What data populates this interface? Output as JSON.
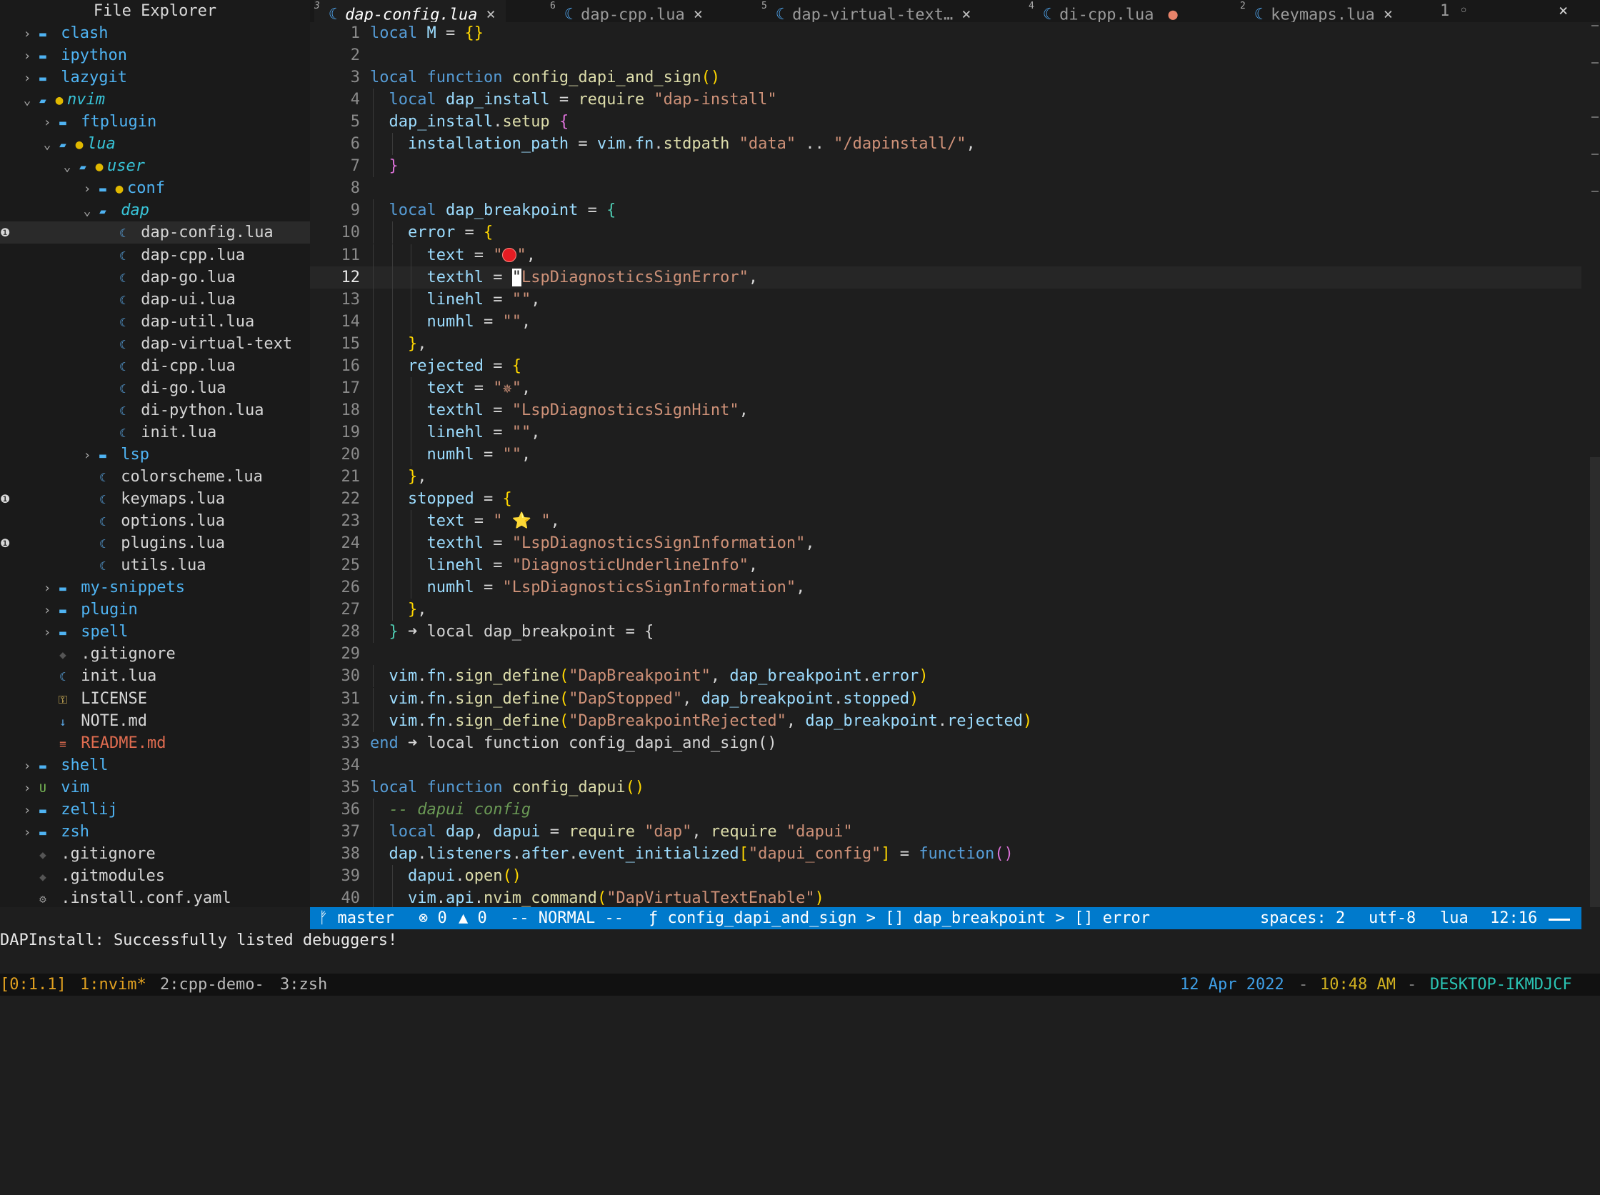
{
  "sidebar": {
    "title": "File Explorer",
    "items": [
      {
        "label": "clash",
        "kind": "folder",
        "depth": 0,
        "chevron": "right"
      },
      {
        "label": "ipython",
        "kind": "folder",
        "depth": 0,
        "chevron": "right"
      },
      {
        "label": "lazygit",
        "kind": "folder",
        "depth": 0,
        "chevron": "right"
      },
      {
        "label": "nvim",
        "kind": "open",
        "depth": 0,
        "chevron": "down",
        "dot": "●"
      },
      {
        "label": "ftplugin",
        "kind": "folder",
        "depth": 1,
        "chevron": "right"
      },
      {
        "label": "lua",
        "kind": "open",
        "depth": 1,
        "chevron": "down",
        "dot": "●"
      },
      {
        "label": "user",
        "kind": "open",
        "depth": 2,
        "chevron": "down",
        "dot": "●"
      },
      {
        "label": "conf",
        "kind": "folder",
        "depth": 3,
        "chevron": "right",
        "dot": "●"
      },
      {
        "label": "dap",
        "kind": "open",
        "depth": 3,
        "chevron": "down"
      },
      {
        "label": "dap-config.lua",
        "kind": "lua",
        "depth": 4,
        "selected": true,
        "diag": "❶"
      },
      {
        "label": "dap-cpp.lua",
        "kind": "lua",
        "depth": 4
      },
      {
        "label": "dap-go.lua",
        "kind": "lua",
        "depth": 4
      },
      {
        "label": "dap-ui.lua",
        "kind": "lua",
        "depth": 4
      },
      {
        "label": "dap-util.lua",
        "kind": "lua",
        "depth": 4
      },
      {
        "label": "dap-virtual-text",
        "kind": "lua",
        "depth": 4
      },
      {
        "label": "di-cpp.lua",
        "kind": "lua",
        "depth": 4
      },
      {
        "label": "di-go.lua",
        "kind": "lua",
        "depth": 4
      },
      {
        "label": "di-python.lua",
        "kind": "lua",
        "depth": 4
      },
      {
        "label": "init.lua",
        "kind": "lua",
        "depth": 4
      },
      {
        "label": "lsp",
        "kind": "folder",
        "depth": 3,
        "chevron": "right"
      },
      {
        "label": "colorscheme.lua",
        "kind": "lua",
        "depth": 3
      },
      {
        "label": "keymaps.lua",
        "kind": "lua",
        "depth": 3,
        "diag": "❶"
      },
      {
        "label": "options.lua",
        "kind": "lua",
        "depth": 3
      },
      {
        "label": "plugins.lua",
        "kind": "lua",
        "depth": 3,
        "diag": "❶"
      },
      {
        "label": "utils.lua",
        "kind": "lua",
        "depth": 3
      },
      {
        "label": "my-snippets",
        "kind": "folder",
        "depth": 1,
        "chevron": "right"
      },
      {
        "label": "plugin",
        "kind": "folder",
        "depth": 1,
        "chevron": "right"
      },
      {
        "label": "spell",
        "kind": "folder",
        "depth": 1,
        "chevron": "right"
      },
      {
        "label": ".gitignore",
        "kind": "git",
        "depth": 1
      },
      {
        "label": "init.lua",
        "kind": "lua",
        "depth": 1
      },
      {
        "label": "LICENSE",
        "kind": "license",
        "depth": 1
      },
      {
        "label": "NOTE.md",
        "kind": "md",
        "depth": 1
      },
      {
        "label": "README.md",
        "kind": "readme",
        "depth": 1
      },
      {
        "label": "shell",
        "kind": "folder",
        "depth": 0,
        "chevron": "right"
      },
      {
        "label": "vim",
        "kind": "folder",
        "depth": 0,
        "chevron": "right",
        "badge": "U"
      },
      {
        "label": "zellij",
        "kind": "folder",
        "depth": 0,
        "chevron": "right"
      },
      {
        "label": "zsh",
        "kind": "folder",
        "depth": 0,
        "chevron": "right"
      },
      {
        "label": ".gitignore",
        "kind": "git",
        "depth": 0
      },
      {
        "label": ".gitmodules",
        "kind": "git",
        "depth": 0
      },
      {
        "label": ".install.conf.yaml",
        "kind": "gear",
        "depth": 0
      }
    ]
  },
  "tabs": [
    {
      "num": "3",
      "label": "dap-config.lua",
      "active": true,
      "right": "×"
    },
    {
      "num": "6",
      "label": "dap-cpp.lua",
      "right": "×"
    },
    {
      "num": "5",
      "label": "dap-virtual-text…",
      "right": "×"
    },
    {
      "num": "4",
      "label": "di-cpp.lua",
      "right": "●",
      "modified": true
    },
    {
      "num": "2",
      "label": "keymaps.lua",
      "right": "×"
    }
  ],
  "tab_count": "1 ◦",
  "close_all": "×",
  "editor": {
    "current_line": 12,
    "lines": [
      {
        "n": "1",
        "html": "<span class='kw'>local</span> <span class='var'>M</span> = <span class='br1'>{}</span>"
      },
      {
        "n": "2",
        "html": ""
      },
      {
        "n": "3",
        "html": "<span class='kw'>local</span> <span class='kw'>function</span> <span class='fn'>config_dapi_and_sign</span><span class='br1'>()</span>"
      },
      {
        "n": "4",
        "html": "  <span class='kw'>local</span> <span class='var'>dap_install</span> = <span class='fn'>require</span> <span class='str'>\"dap-install\"</span>"
      },
      {
        "n": "5",
        "html": "  <span class='var'>dap_install</span>.<span class='fn'>setup</span> <span class='br2'>{</span>"
      },
      {
        "n": "6",
        "html": "    <span class='var'>installation_path</span> = <span class='var'>vim</span>.<span class='var'>fn</span>.<span class='fn'>stdpath</span> <span class='str'>\"data\"</span> .. <span class='str'>\"/dapinstall/\"</span>,"
      },
      {
        "n": "7",
        "html": "  <span class='br2'>}</span>"
      },
      {
        "n": "8",
        "html": ""
      },
      {
        "n": "9",
        "html": "  <span class='kw'>local</span> <span class='var'>dap_breakpoint</span> = <span class='br3'>{</span>"
      },
      {
        "n": "10",
        "html": "    <span class='var'>error</span> = <span class='br1'>{</span>"
      },
      {
        "n": "11",
        "html": "      <span class='var'>text</span> = <span class='str'>\"</span><span class='reddot'></span><span class='str'>\"</span>,"
      },
      {
        "n": "12",
        "html": "      <span class='var'>texthl</span> = <span class='cursor'>\"</span><span class='str'>LspDiagnosticsSignError\"</span>,"
      },
      {
        "n": "13",
        "html": "      <span class='var'>linehl</span> = <span class='str'>\"\"</span>,"
      },
      {
        "n": "14",
        "html": "      <span class='var'>numhl</span> = <span class='str'>\"\"</span>,"
      },
      {
        "n": "15",
        "html": "    <span class='br1'>}</span>,"
      },
      {
        "n": "16",
        "html": "    <span class='var'>rejected</span> = <span class='br1'>{</span>"
      },
      {
        "n": "17",
        "html": "      <span class='var'>text</span> = <span class='str'>\"✵\"</span>,"
      },
      {
        "n": "18",
        "html": "      <span class='var'>texthl</span> = <span class='str'>\"LspDiagnosticsSignHint\"</span>,"
      },
      {
        "n": "19",
        "html": "      <span class='var'>linehl</span> = <span class='str'>\"\"</span>,"
      },
      {
        "n": "20",
        "html": "      <span class='var'>numhl</span> = <span class='str'>\"\"</span>,"
      },
      {
        "n": "21",
        "html": "    <span class='br1'>}</span>,"
      },
      {
        "n": "22",
        "html": "    <span class='var'>stopped</span> = <span class='br1'>{</span>"
      },
      {
        "n": "23",
        "html": "      <span class='var'>text</span> = <span class='str'>\" ⭐ \"</span>,"
      },
      {
        "n": "24",
        "html": "      <span class='var'>texthl</span> = <span class='str'>\"LspDiagnosticsSignInformation\"</span>,"
      },
      {
        "n": "25",
        "html": "      <span class='var'>linehl</span> = <span class='str'>\"DiagnosticUnderlineInfo\"</span>,"
      },
      {
        "n": "26",
        "html": "      <span class='var'>numhl</span> = <span class='str'>\"LspDiagnosticsSignInformation\"</span>,"
      },
      {
        "n": "27",
        "html": "    <span class='br1'>}</span>,"
      },
      {
        "n": "28",
        "html": "  <span class='br3'>}</span> <span class='arr'>➜</span> local dap_breakpoint = {"
      },
      {
        "n": "29",
        "html": ""
      },
      {
        "n": "30",
        "html": "  <span class='var'>vim</span>.<span class='var'>fn</span>.<span class='fn'>sign_define</span><span class='br1'>(</span><span class='str'>\"DapBreakpoint\"</span>, <span class='var'>dap_breakpoint</span>.<span class='var'>error</span><span class='br1'>)</span>"
      },
      {
        "n": "31",
        "html": "  <span class='var'>vim</span>.<span class='var'>fn</span>.<span class='fn'>sign_define</span><span class='br1'>(</span><span class='str'>\"DapStopped\"</span>, <span class='var'>dap_breakpoint</span>.<span class='var'>stopped</span><span class='br1'>)</span>"
      },
      {
        "n": "32",
        "html": "  <span class='var'>vim</span>.<span class='var'>fn</span>.<span class='fn'>sign_define</span><span class='br1'>(</span><span class='str'>\"DapBreakpointRejected\"</span>, <span class='var'>dap_breakpoint</span>.<span class='var'>rejected</span><span class='br1'>)</span>"
      },
      {
        "n": "33",
        "html": "<span class='kw'>end</span> <span class='arr'>➜</span> local function config_dapi_and_sign()"
      },
      {
        "n": "34",
        "html": ""
      },
      {
        "n": "35",
        "html": "<span class='kw'>local</span> <span class='kw'>function</span> <span class='fn'>config_dapui</span><span class='br1'>()</span>"
      },
      {
        "n": "36",
        "html": "  <span class='cmt'>-- dapui config</span>"
      },
      {
        "n": "37",
        "html": "  <span class='kw'>local</span> <span class='var'>dap</span>, <span class='var'>dapui</span> = <span class='fn'>require</span> <span class='str'>\"dap\"</span>, <span class='fn'>require</span> <span class='str'>\"dapui\"</span>"
      },
      {
        "n": "38",
        "html": "  <span class='var'>dap</span>.<span class='var'>listeners</span>.<span class='var'>after</span>.<span class='var'>event_initialized</span><span class='br1'>[</span><span class='str'>\"dapui_config\"</span><span class='br1'>]</span> = <span class='kw'>function</span><span class='br2'>()</span>"
      },
      {
        "n": "39",
        "html": "    <span class='var'>dapui</span>.<span class='fn'>open</span><span class='br1'>()</span>"
      },
      {
        "n": "40",
        "html": "    <span class='var'>vim</span>.<span class='var'>api</span>.<span class='fn'>nvim_command</span><span class='br1'>(</span><span class='str'>\"DapVirtualTextEnable\"</span><span class='br1'>)</span>"
      }
    ]
  },
  "status": {
    "branch": "ᚠ master",
    "errors": "⊗ 0",
    "warnings": "▲ 0",
    "mode": "-- NORMAL --",
    "breadcrumb": "ƒ config_dapi_and_sign > [] dap_breakpoint > [] error",
    "spaces": "spaces: 2",
    "encoding": "utf-8",
    "filetype": "lua",
    "position": "12:16"
  },
  "message": "DAPInstall: Successfully listed debuggers!",
  "tmux": {
    "session": "[0:1.1]",
    "win1": "1:nvim*",
    "win2": "2:cpp-demo-",
    "win3": "3:zsh",
    "date": "12 Apr 2022",
    "sep1": "-",
    "time": "10:48 AM",
    "sep2": "-",
    "host": "DESKTOP-IKMDJCF"
  },
  "colors": {
    "status_bg": "#007acc",
    "folder": "#4fb3f2",
    "string": "#ce9178",
    "keyword": "#569cd6"
  }
}
